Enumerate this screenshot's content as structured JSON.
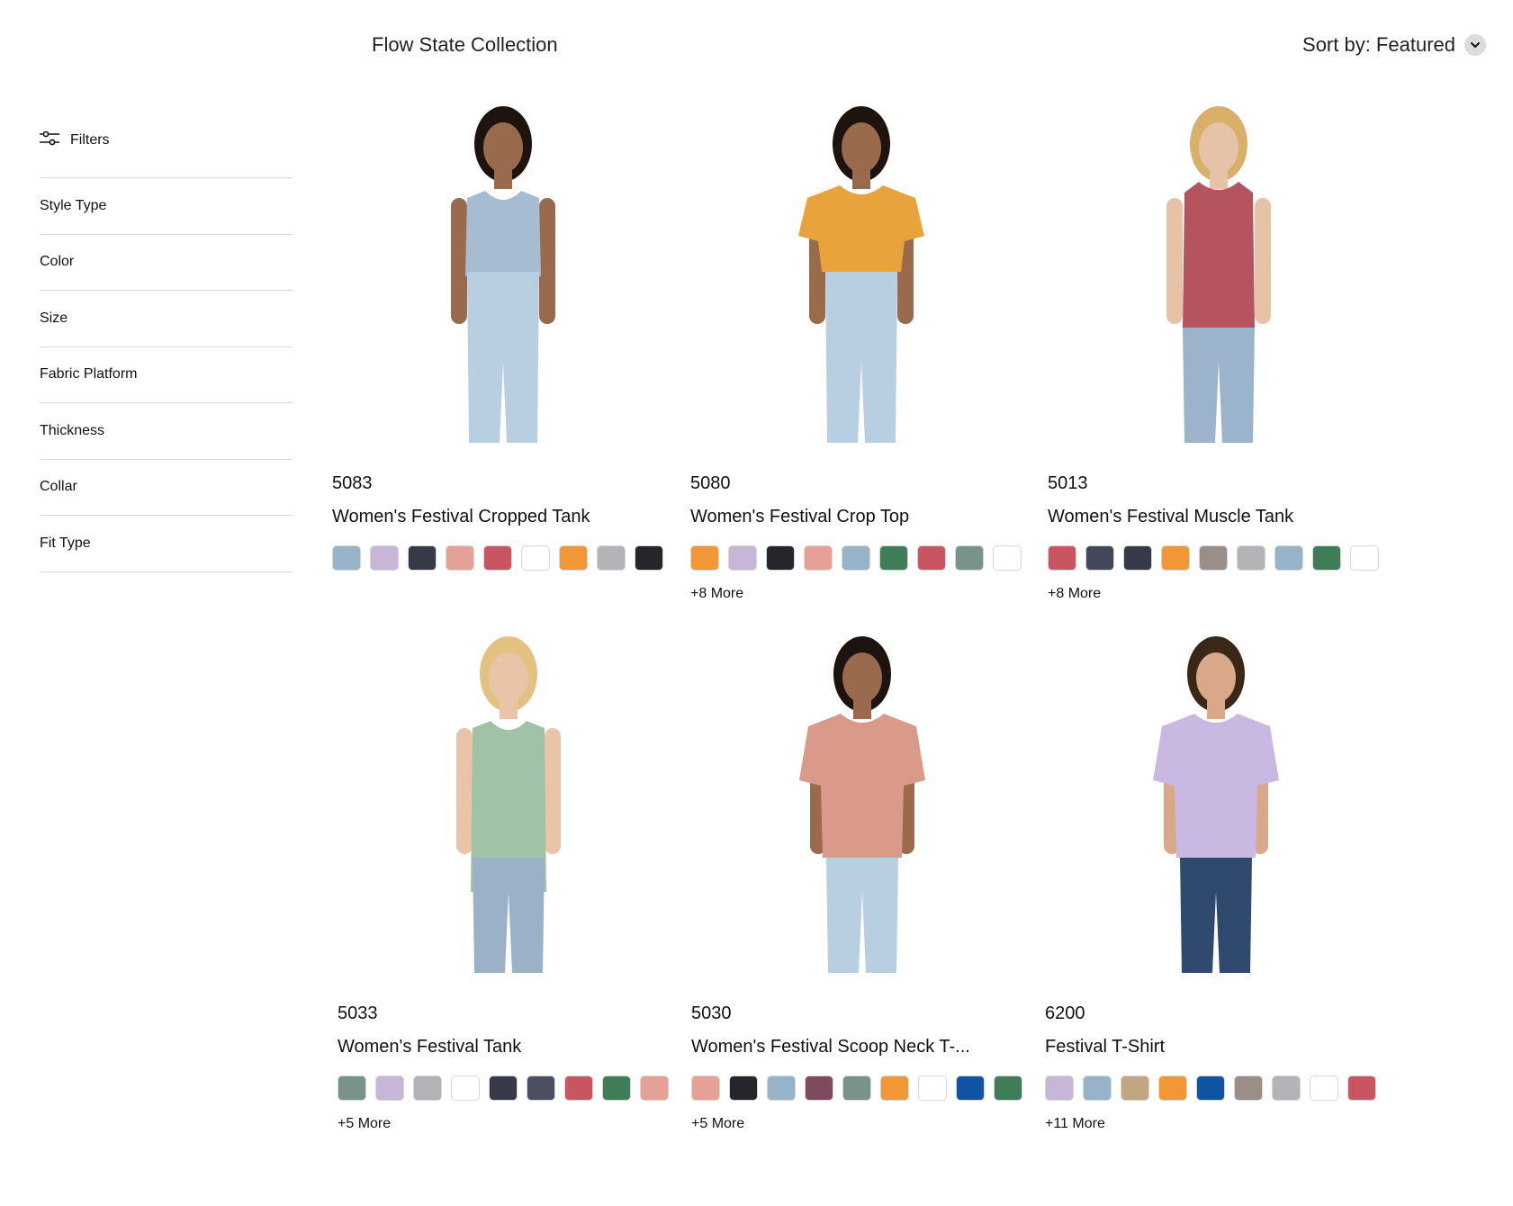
{
  "header": {
    "title": "Flow State Collection",
    "sort_label": "Sort by: Featured"
  },
  "sidebar": {
    "filters_label": "Filters",
    "items": [
      "Style Type",
      "Color",
      "Size",
      "Fabric Platform",
      "Thickness",
      "Collar",
      "Fit Type"
    ]
  },
  "products": [
    {
      "sku": "5083",
      "name": "Women's Festival Cropped Tank",
      "more": "",
      "garment": "tank",
      "garment_color": "#a6bdd1",
      "hair": "#1d1410",
      "skin": "#9a6a4c",
      "pants": "#b8cfe2",
      "swatches": [
        "#97b3c9",
        "#c7b6d6",
        "#363948",
        "#e5a195",
        "#c95563",
        "#ffffff",
        "#f29735",
        "#b3b3b8",
        "#25262b"
      ]
    },
    {
      "sku": "5080",
      "name": "Women's Festival Crop Top",
      "more": "+8 More",
      "garment": "croptee",
      "garment_color": "#e9a33c",
      "hair": "#1d1410",
      "skin": "#9a6a4c",
      "pants": "#b8cfe2",
      "swatches": [
        "#f29735",
        "#c7b6d6",
        "#25262b",
        "#e5a195",
        "#97b3c9",
        "#3f7d59",
        "#c95563",
        "#7a9388",
        "#ffffff"
      ]
    },
    {
      "sku": "5013",
      "name": "Women's Festival Muscle Tank",
      "more": "+8 More",
      "garment": "muscle",
      "garment_color": "#b5545e",
      "hair": "#d9b06a",
      "skin": "#e6c2a6",
      "pants": "#9bb4cc",
      "swatches": [
        "#c95563",
        "#43475a",
        "#363948",
        "#f29735",
        "#9a8f88",
        "#b3b3b8",
        "#97b3c9",
        "#3f7d59",
        "#ffffff"
      ]
    },
    {
      "sku": "5033",
      "name": "Women's Festival Tank",
      "more": "+5 More",
      "garment": "tank",
      "garment_color": "#a0c2a6",
      "hair": "#e2c181",
      "skin": "#e9c4a6",
      "pants": "#9bb1c8",
      "swatches": [
        "#7a9388",
        "#c7b6d6",
        "#b3b3b8",
        "#ffffff",
        "#363948",
        "#4a4f61",
        "#c95563",
        "#3f7d59",
        "#e5a195"
      ]
    },
    {
      "sku": "5030",
      "name": "Women's Festival Scoop Neck T-...",
      "more": "+5 More",
      "garment": "tee",
      "garment_color": "#d99a8a",
      "hair": "#1d1410",
      "skin": "#9a6a4c",
      "pants": "#b8cfe2",
      "swatches": [
        "#e5a195",
        "#25262b",
        "#97b3c9",
        "#7e4a5e",
        "#7a9388",
        "#f29735",
        "#ffffff",
        "#0f53a2",
        "#3f7d59"
      ]
    },
    {
      "sku": "6200",
      "name": "Festival T-Shirt",
      "more": "+11 More",
      "garment": "tee",
      "garment_color": "#c9b8e1",
      "hair": "#3a2718",
      "skin": "#d9a889",
      "pants": "#2f4a6e",
      "swatches": [
        "#c7b6d6",
        "#97b3c9",
        "#c4a582",
        "#f29735",
        "#0f53a2",
        "#9a8f88",
        "#b3b3b8",
        "#ffffff",
        "#c95563"
      ]
    }
  ]
}
